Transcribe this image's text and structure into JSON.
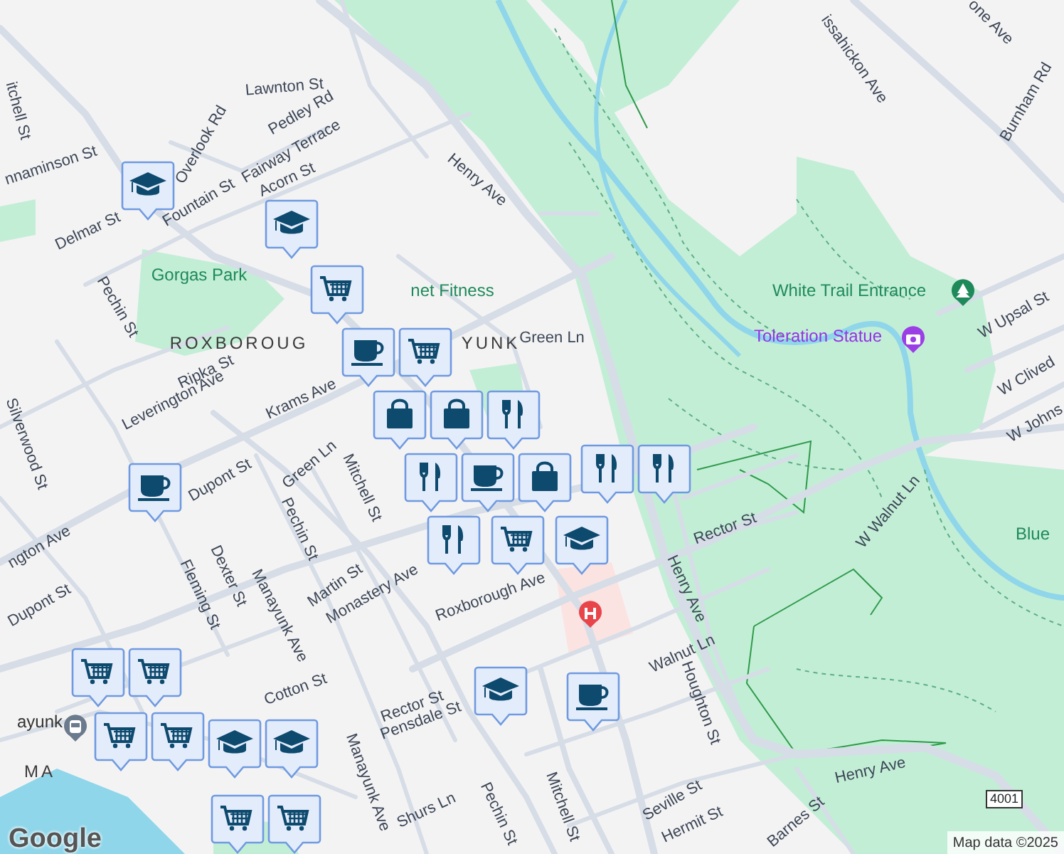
{
  "map": {
    "labels": [
      {
        "text": "Lawnton St",
        "kind": "street"
      },
      {
        "text": "Pedley Rd",
        "kind": "street"
      },
      {
        "text": "Fairway Terrace",
        "kind": "street"
      },
      {
        "text": "Overlook Rd",
        "kind": "street"
      },
      {
        "text": "Acorn St",
        "kind": "street"
      },
      {
        "text": "Fountain St",
        "kind": "street"
      },
      {
        "text": "Delmar St",
        "kind": "street"
      },
      {
        "text": "nnaminson St",
        "kind": "street"
      },
      {
        "text": "itchell St",
        "kind": "street"
      },
      {
        "text": "Henry Ave",
        "kind": "street"
      },
      {
        "text": "Gorgas Park",
        "kind": "park"
      },
      {
        "text": "net Fitness",
        "kind": "park"
      },
      {
        "text": "Green Ln",
        "kind": "street"
      },
      {
        "text": "Pechin St",
        "kind": "street"
      },
      {
        "text": "ROXBOROUG",
        "kind": "district"
      },
      {
        "text": "YUNK",
        "kind": "district"
      },
      {
        "text": "Ripka St",
        "kind": "street"
      },
      {
        "text": "Leverington Ave",
        "kind": "street"
      },
      {
        "text": "Krams Ave",
        "kind": "street"
      },
      {
        "text": "Silverwood St",
        "kind": "street"
      },
      {
        "text": "Dupont St",
        "kind": "street"
      },
      {
        "text": "Green Ln",
        "kind": "street"
      },
      {
        "text": "Mitchell St",
        "kind": "street"
      },
      {
        "text": "Pechin St",
        "kind": "street"
      },
      {
        "text": "Martin St",
        "kind": "street"
      },
      {
        "text": "Monastery Ave",
        "kind": "street"
      },
      {
        "text": "Manayunk Ave",
        "kind": "street"
      },
      {
        "text": "Dexter St",
        "kind": "street"
      },
      {
        "text": "Fleming St",
        "kind": "street"
      },
      {
        "text": "Dupont St",
        "kind": "street"
      },
      {
        "text": "ngton Ave",
        "kind": "street"
      },
      {
        "text": "Roxborough Ave",
        "kind": "street"
      },
      {
        "text": "Cotton St",
        "kind": "street"
      },
      {
        "text": "Rector St",
        "kind": "street"
      },
      {
        "text": "Pensdale St",
        "kind": "street"
      },
      {
        "text": "Manayunk Ave",
        "kind": "street"
      },
      {
        "text": "Shurs Ln",
        "kind": "street"
      },
      {
        "text": "Pechin St",
        "kind": "street"
      },
      {
        "text": "Mitchell St",
        "kind": "street"
      },
      {
        "text": "Seville St",
        "kind": "street"
      },
      {
        "text": "Hermit St",
        "kind": "street"
      },
      {
        "text": "Barnes St",
        "kind": "street"
      },
      {
        "text": "Henry Ave",
        "kind": "street"
      },
      {
        "text": "Houghton St",
        "kind": "street"
      },
      {
        "text": "Walnut Ln",
        "kind": "street"
      },
      {
        "text": "Henry Ave",
        "kind": "street"
      },
      {
        "text": "Rector St",
        "kind": "street"
      },
      {
        "text": "W Walnut Ln",
        "kind": "street"
      },
      {
        "text": "Blue",
        "kind": "park"
      },
      {
        "text": "W Johns",
        "kind": "street"
      },
      {
        "text": "W Clived",
        "kind": "street"
      },
      {
        "text": "W Upsal St",
        "kind": "street"
      },
      {
        "text": "White Trail Entrance",
        "kind": "park"
      },
      {
        "text": "Toleration Statue",
        "kind": "attraction"
      },
      {
        "text": "issahickon Ave",
        "kind": "street"
      },
      {
        "text": "Burnham Rd",
        "kind": "street"
      },
      {
        "text": "one Ave",
        "kind": "street"
      },
      {
        "text": "ayunk",
        "kind": "transit"
      },
      {
        "text": "MA",
        "kind": "district"
      }
    ],
    "pins": [
      {
        "kind": "school"
      },
      {
        "kind": "school"
      },
      {
        "kind": "cart"
      },
      {
        "kind": "coffee"
      },
      {
        "kind": "cart"
      },
      {
        "kind": "bag"
      },
      {
        "kind": "bag"
      },
      {
        "kind": "food"
      },
      {
        "kind": "food"
      },
      {
        "kind": "coffee"
      },
      {
        "kind": "bag"
      },
      {
        "kind": "food"
      },
      {
        "kind": "cart"
      },
      {
        "kind": "school"
      },
      {
        "kind": "food"
      },
      {
        "kind": "food"
      },
      {
        "kind": "coffee"
      },
      {
        "kind": "school"
      },
      {
        "kind": "coffee"
      },
      {
        "kind": "cart"
      },
      {
        "kind": "cart"
      },
      {
        "kind": "cart"
      },
      {
        "kind": "cart"
      },
      {
        "kind": "school"
      },
      {
        "kind": "school"
      },
      {
        "kind": "cart"
      },
      {
        "kind": "cart"
      }
    ],
    "route_shield": "4001",
    "logo": "Google",
    "attribution": "Map data ©2025"
  }
}
